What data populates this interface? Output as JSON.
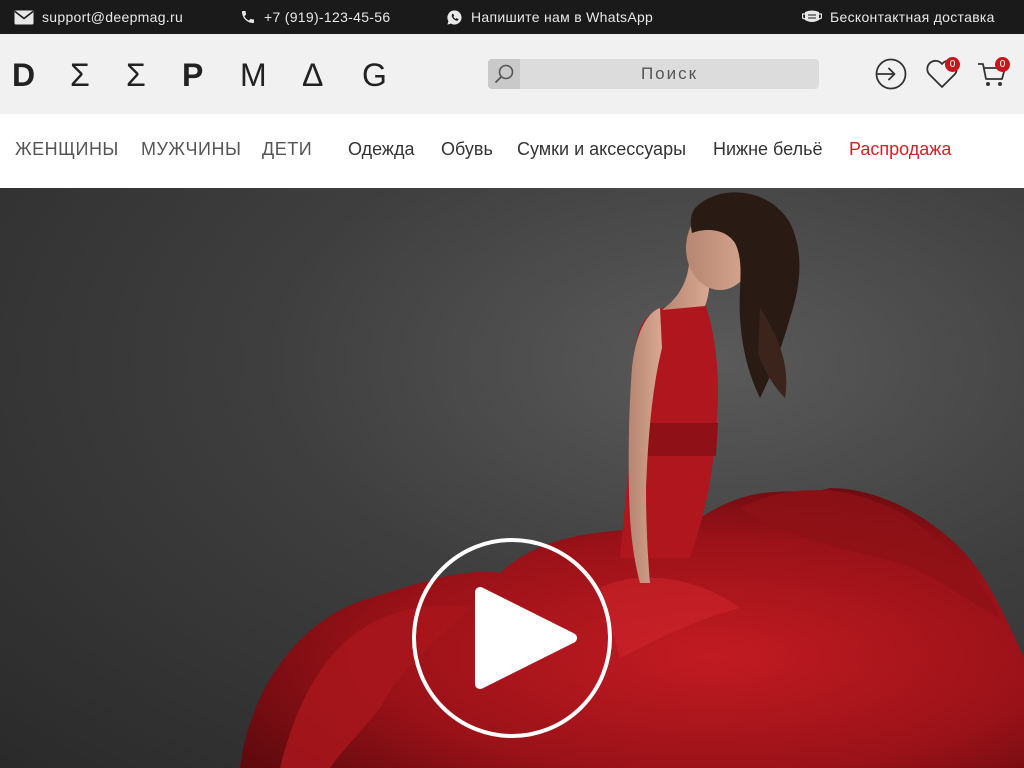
{
  "topbar": {
    "email": "support@deepmag.ru",
    "phone": "+7 (919)-123-45-56",
    "whatsapp": "Напишите нам в WhatsApp",
    "delivery": "Бесконтактная доставка"
  },
  "header": {
    "logo_letters": [
      "D",
      "Σ",
      "Σ",
      "P",
      "M",
      "Δ",
      "G"
    ],
    "search_placeholder": "Поиск",
    "wishlist_count": "0",
    "cart_count": "0"
  },
  "nav": {
    "genders": [
      "ЖЕНЩИНЫ",
      "МУЖЧИНЫ",
      "ДЕТИ"
    ],
    "categories": [
      "Одежда",
      "Обувь",
      "Сумки и аксессуары",
      "Нижне бельё"
    ],
    "sale": "Распродажа"
  },
  "colors": {
    "accent": "#d32027",
    "badge": "#c8161d",
    "topbar_bg": "#1a1a1a",
    "header_bg": "#f1f1f1",
    "dress": "#b3161d"
  },
  "hero": {
    "play_icon": "play-icon"
  }
}
